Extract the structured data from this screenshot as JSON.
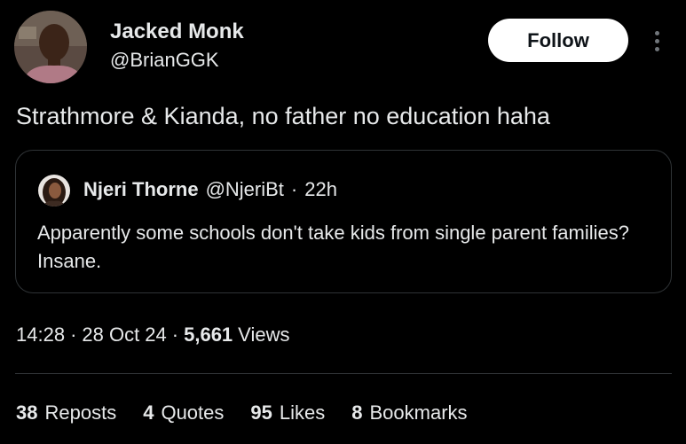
{
  "author": {
    "name": "Jacked Monk",
    "handle": "@BrianGGK"
  },
  "actions": {
    "follow_label": "Follow",
    "more_icon": "more-vertical-icon"
  },
  "tweet": {
    "text": "Strathmore & Kianda, no father no education haha"
  },
  "quote": {
    "name": "Njeri Thorne",
    "handle": "@NjeriBt",
    "separator": "·",
    "time": "22h",
    "text": "Apparently some schools don't take kids from single parent families? Insane."
  },
  "meta": {
    "time": "14:28",
    "separator": "·",
    "date": "28 Oct 24",
    "views_count": "5,661",
    "views_label": "Views"
  },
  "stats": [
    {
      "count": "38",
      "label": "Reposts"
    },
    {
      "count": "4",
      "label": "Quotes"
    },
    {
      "count": "95",
      "label": "Likes"
    },
    {
      "count": "8",
      "label": "Bookmarks"
    }
  ],
  "colors": {
    "background": "#000000",
    "text": "#e7e9ea",
    "muted": "#71767b",
    "border": "#2f3336",
    "follow_bg": "#ffffff"
  }
}
